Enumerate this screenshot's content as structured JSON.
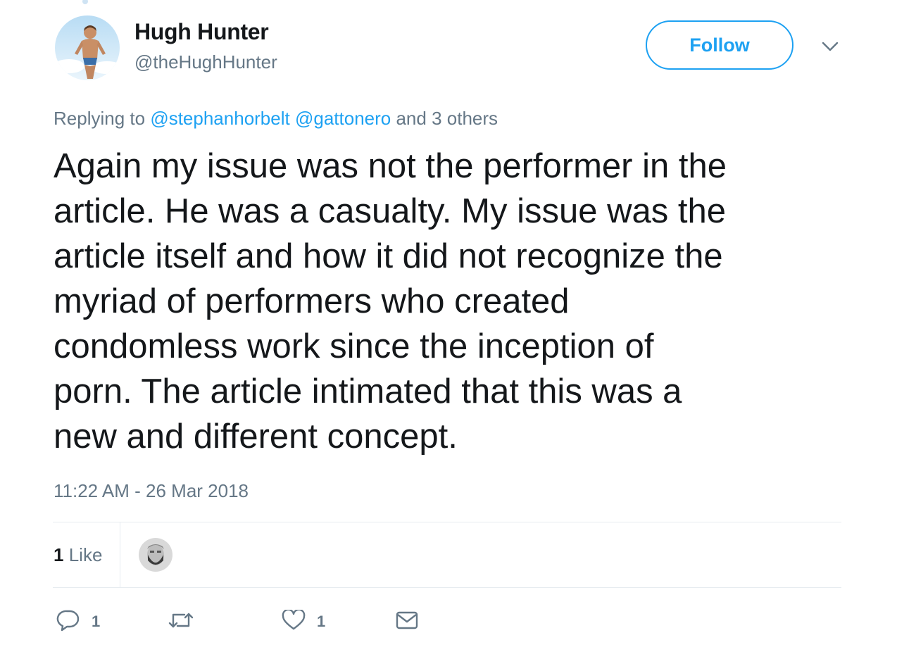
{
  "author": {
    "name": "Hugh Hunter",
    "handle": "@theHughHunter"
  },
  "follow_button": {
    "label": "Follow"
  },
  "reply_context": {
    "prefix": "Replying to",
    "mentions": [
      "@stephanhorbelt",
      "@gattonero"
    ],
    "suffix": "and 3 others"
  },
  "tweet": {
    "text": "Again my issue was not the performer in the\narticle. He was a casualty. My issue was the\narticle itself and how it did not recognize the\nmyriad of performers who created\ncondomless work since the inception of\nporn. The article intimated that this was a\nnew and different concept.",
    "timestamp": "11:22 AM - 26 Mar 2018"
  },
  "stats": {
    "likes_count": "1",
    "likes_label": "Like"
  },
  "actions": {
    "reply": {
      "icon": "reply-icon",
      "count": "1"
    },
    "retweet": {
      "icon": "retweet-icon",
      "count": ""
    },
    "like": {
      "icon": "heart-icon",
      "count": "1"
    },
    "dm": {
      "icon": "envelope-icon"
    }
  },
  "colors": {
    "accent": "#1da1f2",
    "secondary_text": "#657786",
    "primary_text": "#14171a",
    "divider": "#e6ecf0"
  }
}
